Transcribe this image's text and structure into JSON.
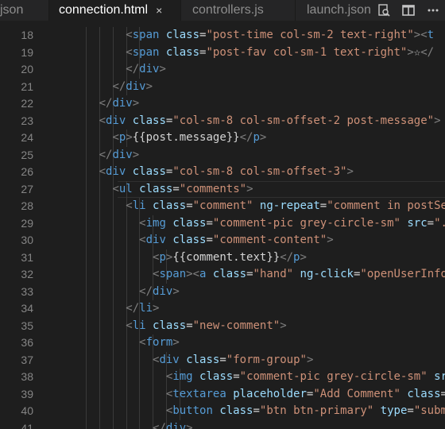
{
  "tabs": [
    {
      "label": "json",
      "active": false
    },
    {
      "label": "connection.html",
      "active": true,
      "close": "×"
    },
    {
      "label": "controllers.js",
      "active": false
    },
    {
      "label": "launch.json",
      "active": false
    }
  ],
  "toolbar": {
    "icons": [
      "open-changes-icon",
      "split-editor-icon",
      "more-icon"
    ]
  },
  "colors": {
    "tag": "#569cd6",
    "attr": "#9cdcfe",
    "string": "#ce9178",
    "punct": "#808080",
    "text": "#d4d4d4",
    "line_number": "#858585",
    "background": "#1e1e1e",
    "tabbar": "#252526"
  },
  "editor": {
    "current_line": 27,
    "lines": [
      {
        "n": 18,
        "indent": 10,
        "code": [
          [
            "<",
            "p"
          ],
          [
            "span",
            "t"
          ],
          [
            " "
          ],
          [
            "class",
            "a"
          ],
          [
            "=",
            "x"
          ],
          [
            "\"post-time col-sm-2 text-right\"",
            "s"
          ],
          [
            ">",
            "p"
          ],
          [
            "<",
            "p"
          ],
          [
            "t",
            "t"
          ]
        ]
      },
      {
        "n": 19,
        "indent": 10,
        "code": [
          [
            "<",
            "p"
          ],
          [
            "span",
            "t"
          ],
          [
            " "
          ],
          [
            "class",
            "a"
          ],
          [
            "=",
            "x"
          ],
          [
            "\"post-fav col-sm-1 text-right\"",
            "s"
          ],
          [
            ">",
            "p"
          ],
          [
            "☆",
            "x"
          ],
          [
            "</",
            "p"
          ]
        ]
      },
      {
        "n": 20,
        "indent": 10,
        "code": [
          [
            "</",
            "p"
          ],
          [
            "div",
            "t"
          ],
          [
            ">",
            "p"
          ]
        ]
      },
      {
        "n": 21,
        "indent": 8,
        "code": [
          [
            "</",
            "p"
          ],
          [
            "div",
            "t"
          ],
          [
            ">",
            "p"
          ]
        ]
      },
      {
        "n": 22,
        "indent": 6,
        "code": [
          [
            "</",
            "p"
          ],
          [
            "div",
            "t"
          ],
          [
            ">",
            "p"
          ]
        ]
      },
      {
        "n": 23,
        "indent": 6,
        "code": [
          [
            "<",
            "p"
          ],
          [
            "div",
            "t"
          ],
          [
            " "
          ],
          [
            "class",
            "a"
          ],
          [
            "=",
            "x"
          ],
          [
            "\"col-sm-8 col-sm-offset-2 post-message\"",
            "s"
          ],
          [
            ">",
            "p"
          ]
        ]
      },
      {
        "n": 24,
        "indent": 8,
        "code": [
          [
            "<",
            "p"
          ],
          [
            "p",
            "t"
          ],
          [
            ">",
            "p"
          ],
          [
            "{{post.message}}",
            "x"
          ],
          [
            "</",
            "p"
          ],
          [
            "p",
            "t"
          ],
          [
            ">",
            "p"
          ]
        ]
      },
      {
        "n": 25,
        "indent": 6,
        "code": [
          [
            "</",
            "p"
          ],
          [
            "div",
            "t"
          ],
          [
            ">",
            "p"
          ]
        ]
      },
      {
        "n": 26,
        "indent": 6,
        "code": [
          [
            "<",
            "p"
          ],
          [
            "div",
            "t"
          ],
          [
            " "
          ],
          [
            "class",
            "a"
          ],
          [
            "=",
            "x"
          ],
          [
            "\"col-sm-8 col-sm-offset-3\"",
            "s"
          ],
          [
            ">",
            "p"
          ]
        ]
      },
      {
        "n": 27,
        "indent": 8,
        "code": [
          [
            "<",
            "p"
          ],
          [
            "ul",
            "t"
          ],
          [
            " "
          ],
          [
            "class",
            "a"
          ],
          [
            "=",
            "x"
          ],
          [
            "\"comments\"",
            "s"
          ],
          [
            ">",
            "p"
          ]
        ]
      },
      {
        "n": 28,
        "indent": 10,
        "code": [
          [
            "<",
            "p"
          ],
          [
            "li",
            "t"
          ],
          [
            " "
          ],
          [
            "class",
            "a"
          ],
          [
            "=",
            "x"
          ],
          [
            "\"comment\"",
            "s"
          ],
          [
            " "
          ],
          [
            "ng-repeat",
            "a"
          ],
          [
            "=",
            "x"
          ],
          [
            "\"comment in postSe",
            "s"
          ]
        ]
      },
      {
        "n": 29,
        "indent": 12,
        "code": [
          [
            "<",
            "p"
          ],
          [
            "img",
            "t"
          ],
          [
            " "
          ],
          [
            "class",
            "a"
          ],
          [
            "=",
            "x"
          ],
          [
            "\"comment-pic grey-circle-sm\"",
            "s"
          ],
          [
            " "
          ],
          [
            "src",
            "a"
          ],
          [
            "=",
            "x"
          ],
          [
            "\".",
            "s"
          ]
        ]
      },
      {
        "n": 30,
        "indent": 12,
        "code": [
          [
            "<",
            "p"
          ],
          [
            "div",
            "t"
          ],
          [
            " "
          ],
          [
            "class",
            "a"
          ],
          [
            "=",
            "x"
          ],
          [
            "\"comment-content\"",
            "s"
          ],
          [
            ">",
            "p"
          ]
        ]
      },
      {
        "n": 31,
        "indent": 14,
        "code": [
          [
            "<",
            "p"
          ],
          [
            "p",
            "t"
          ],
          [
            ">",
            "p"
          ],
          [
            "{{comment.text}}",
            "x"
          ],
          [
            "</",
            "p"
          ],
          [
            "p",
            "t"
          ],
          [
            ">",
            "p"
          ]
        ]
      },
      {
        "n": 32,
        "indent": 14,
        "code": [
          [
            "<",
            "p"
          ],
          [
            "span",
            "t"
          ],
          [
            ">",
            "p"
          ],
          [
            "<",
            "p"
          ],
          [
            "a",
            "t"
          ],
          [
            " "
          ],
          [
            "class",
            "a"
          ],
          [
            "=",
            "x"
          ],
          [
            "\"hand\"",
            "s"
          ],
          [
            " "
          ],
          [
            "ng-click",
            "a"
          ],
          [
            "=",
            "x"
          ],
          [
            "\"openUserInfo",
            "s"
          ]
        ]
      },
      {
        "n": 33,
        "indent": 12,
        "code": [
          [
            "</",
            "p"
          ],
          [
            "div",
            "t"
          ],
          [
            ">",
            "p"
          ]
        ]
      },
      {
        "n": 34,
        "indent": 10,
        "code": [
          [
            "</",
            "p"
          ],
          [
            "li",
            "t"
          ],
          [
            ">",
            "p"
          ]
        ]
      },
      {
        "n": 35,
        "indent": 10,
        "code": [
          [
            "<",
            "p"
          ],
          [
            "li",
            "t"
          ],
          [
            " "
          ],
          [
            "class",
            "a"
          ],
          [
            "=",
            "x"
          ],
          [
            "\"new-comment\"",
            "s"
          ],
          [
            ">",
            "p"
          ]
        ]
      },
      {
        "n": 36,
        "indent": 12,
        "code": [
          [
            "<",
            "p"
          ],
          [
            "form",
            "t"
          ],
          [
            ">",
            "p"
          ]
        ]
      },
      {
        "n": 37,
        "indent": 14,
        "code": [
          [
            "<",
            "p"
          ],
          [
            "div",
            "t"
          ],
          [
            " "
          ],
          [
            "class",
            "a"
          ],
          [
            "=",
            "x"
          ],
          [
            "\"form-group\"",
            "s"
          ],
          [
            ">",
            "p"
          ]
        ]
      },
      {
        "n": 38,
        "indent": 16,
        "code": [
          [
            "<",
            "p"
          ],
          [
            "img",
            "t"
          ],
          [
            " "
          ],
          [
            "class",
            "a"
          ],
          [
            "=",
            "x"
          ],
          [
            "\"comment-pic grey-circle-sm\"",
            "s"
          ],
          [
            " "
          ],
          [
            "sr",
            "a"
          ]
        ]
      },
      {
        "n": 39,
        "indent": 16,
        "code": [
          [
            "<",
            "p"
          ],
          [
            "textarea",
            "t"
          ],
          [
            " "
          ],
          [
            "placeholder",
            "a"
          ],
          [
            "=",
            "x"
          ],
          [
            "\"Add Comment\"",
            "s"
          ],
          [
            " "
          ],
          [
            "class",
            "a"
          ],
          [
            "=",
            "x"
          ]
        ]
      },
      {
        "n": 40,
        "indent": 16,
        "code": [
          [
            "<",
            "p"
          ],
          [
            "button",
            "t"
          ],
          [
            " "
          ],
          [
            "class",
            "a"
          ],
          [
            "=",
            "x"
          ],
          [
            "\"btn btn-primary\"",
            "s"
          ],
          [
            " "
          ],
          [
            "type",
            "a"
          ],
          [
            "=",
            "x"
          ],
          [
            "\"subm",
            "s"
          ]
        ]
      },
      {
        "n": 41,
        "indent": 14,
        "code": [
          [
            "</",
            "p"
          ],
          [
            "div",
            "t"
          ],
          [
            ">",
            "p"
          ]
        ]
      }
    ]
  }
}
